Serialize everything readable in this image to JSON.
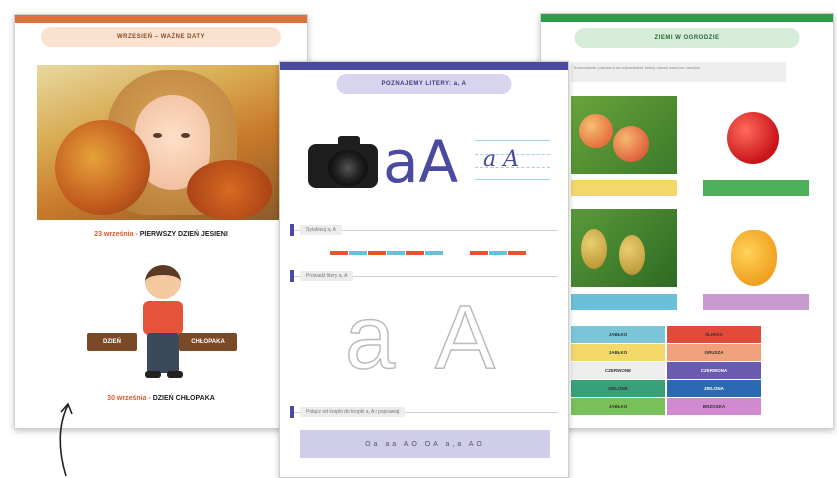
{
  "pages": {
    "sept": {
      "header": "WRZESIEŃ – WAŻNE DATY",
      "events": [
        {
          "date": "23 września",
          "sep": " - ",
          "title": "PIERWSZY DZIEŃ JESIENI"
        },
        {
          "date": "30 września",
          "sep": " - ",
          "title": "DZIEŃ CHŁOPAKA"
        }
      ],
      "signs": {
        "left": "DZIEŃ",
        "right": "CHŁOPAKA"
      }
    },
    "letters": {
      "header": "POZNAJEMY LITERY: a, A",
      "big_letters": "aA",
      "script_letters": "a A",
      "sections": [
        "Sylabizuj a, A",
        "Prowadź litery a, A",
        "Połącz od kropki do kropki a, A i poprawiaj"
      ],
      "outline_letters": [
        "a",
        "A"
      ],
      "bottom_text": "Oa aa  AO  OA  a,a  AO"
    },
    "garden": {
      "header": "ZIEMI W OGRODZIE",
      "instruction": "Kolorowanie: pokoloruj na odpowiednie kolory nazwy owoców i warzyw",
      "table": [
        [
          "JABŁKO",
          "ŚLIWKA"
        ],
        [
          "JABŁKO",
          "GRUSZA"
        ],
        [
          "CZERWONE",
          "CZERWONA"
        ],
        [
          "ZIELONE",
          "ZIELONA"
        ],
        [
          "JABŁKO",
          "BRZOSKA"
        ]
      ]
    }
  },
  "colors": {
    "sept_accent": "#d9733a",
    "letters_accent": "#4a4aa0",
    "garden_accent": "#2e9a4a"
  }
}
